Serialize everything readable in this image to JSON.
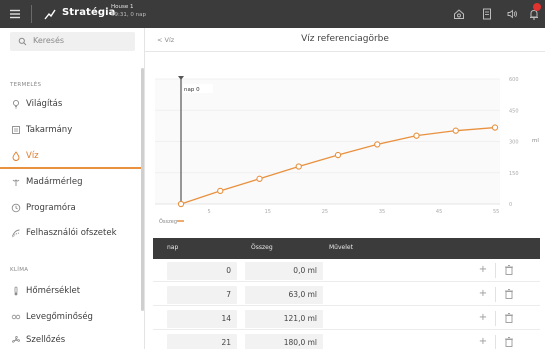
{
  "topbar": {
    "app_name": "Stratégia",
    "house": "House 1",
    "time_day": "09:31, 0 nap",
    "notification_count": ""
  },
  "sidebar": {
    "search_placeholder": "Keresés",
    "sections": [
      {
        "title": "TERMELÉS",
        "items": [
          {
            "label": "Világítás",
            "icon": "lightbulb-icon"
          },
          {
            "label": "Takarmány",
            "icon": "feed-icon"
          },
          {
            "label": "Víz",
            "icon": "water-drop-icon",
            "active": true
          },
          {
            "label": "Madármérleg",
            "icon": "bird-scale-icon"
          },
          {
            "label": "Programóra",
            "icon": "clock-icon"
          },
          {
            "label": "Felhasználói ofszetek",
            "icon": "offset-icon"
          }
        ]
      },
      {
        "title": "KLÍMA",
        "items": [
          {
            "label": "Hőmérséklet",
            "icon": "thermometer-icon"
          },
          {
            "label": "Levegőminőség",
            "icon": "co2-icon"
          },
          {
            "label": "Szellőzés",
            "icon": "fan-icon"
          }
        ]
      }
    ]
  },
  "main": {
    "back_label": "< Víz",
    "title": "Víz referenciagörbe",
    "table": {
      "headers": [
        "nap",
        "Összeg",
        "Művelet"
      ],
      "rows": [
        {
          "nap": "0",
          "osszeg": "0,0 ml"
        },
        {
          "nap": "7",
          "osszeg": "63,0 ml"
        },
        {
          "nap": "14",
          "osszeg": "121,0 ml"
        },
        {
          "nap": "21",
          "osszeg": "180,0 ml"
        }
      ]
    }
  },
  "colors": {
    "accent": "#e8913f",
    "topbar_bg": "#3b3b3b",
    "table_header_bg": "#3b3b3b"
  },
  "chart_data": {
    "type": "line",
    "series": [
      {
        "name": "Összeg",
        "x": [
          0,
          7,
          14,
          21,
          28,
          35,
          42,
          49,
          56
        ],
        "values": [
          0,
          63,
          121,
          180,
          235,
          286,
          328,
          352,
          367
        ]
      }
    ],
    "xticks": [
      "5",
      "15",
      "25",
      "35",
      "45",
      "55"
    ],
    "yticks_right": [
      "0",
      "150",
      "300",
      "450",
      "600"
    ],
    "ylabel": "ml",
    "cursor_label": "nap 0",
    "legend": "Összeg",
    "legend_position": "bottom-left"
  }
}
